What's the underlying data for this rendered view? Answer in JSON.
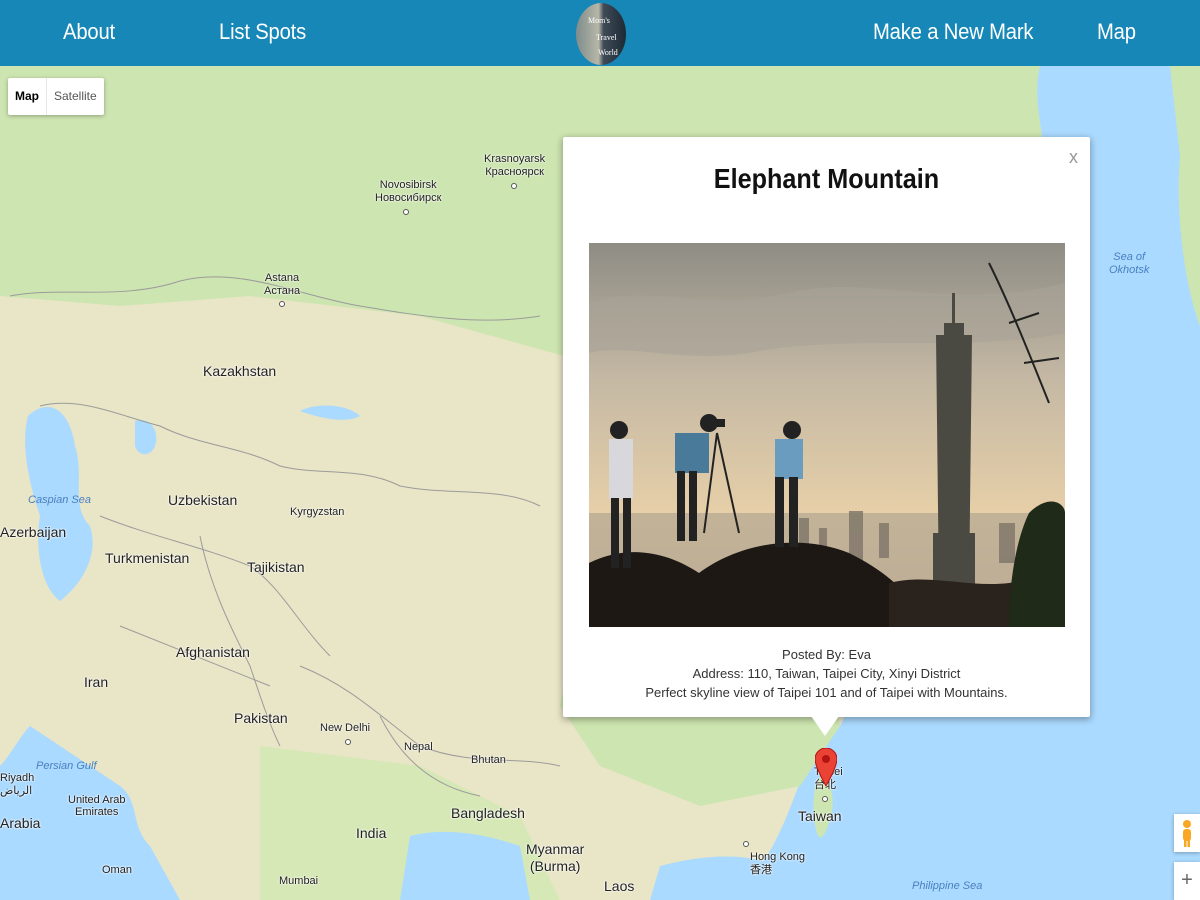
{
  "nav": {
    "about": "About",
    "list_spots": "List Spots",
    "logo_text": [
      "Mom's",
      "Travel",
      "World"
    ],
    "new_mark": "Make a New Mark",
    "map": "Map"
  },
  "map_controls": {
    "type_map": "Map",
    "type_satellite": "Satellite",
    "zoom_in": "+"
  },
  "map_labels": {
    "kazakhstan": "Kazakhstan",
    "uzbekistan": "Uzbekistan",
    "turkmenistan": "Turkmenistan",
    "tajikistan": "Tajikistan",
    "kyrgyzstan": "Kyrgyzstan",
    "afghanistan": "Afghanistan",
    "iran": "Iran",
    "pakistan": "Pakistan",
    "azerbaijan": "Azerbaijan",
    "india": "India",
    "nepal": "Nepal",
    "bhutan": "Bhutan",
    "bangladesh": "Bangladesh",
    "myanmar": "Myanmar\n(Burma)",
    "laos": "Laos",
    "taiwan": "Taiwan",
    "uae": "United Arab\nEmirates",
    "arabia": "Arabia",
    "oman": "Oman",
    "riyadh": "Riyadh\nالرياض",
    "new_delhi": "New Delhi",
    "mumbai": "Mumbai",
    "hong_kong": "Hong Kong\n香港",
    "taipei": "Taipei\n台北",
    "astana": "Astana\nАстана",
    "novosibirsk": "Novosibirsk\nНовосибирск",
    "krasnoyarsk": "Krasnoyarsk\nКрасноярск",
    "caspian_sea": "Caspian Sea",
    "persian_gulf": "Persian Gulf",
    "sea_of_okhotsk": "Sea of\nOkhotsk",
    "philippine_sea": "Philippine Sea"
  },
  "info_window": {
    "close": "x",
    "title": "Elephant Mountain",
    "posted_by": "Posted By: Eva",
    "address": "Address: 110, Taiwan, Taipei City, Xinyi District",
    "description": "Perfect skyline view of Taipei 101 and of Taipei with Mountains."
  },
  "colors": {
    "nav_bg": "#1687b6",
    "land": "#e9e5c7",
    "forest": "#cde5b0",
    "water": "#aadaff",
    "marker": "#ea4335"
  }
}
